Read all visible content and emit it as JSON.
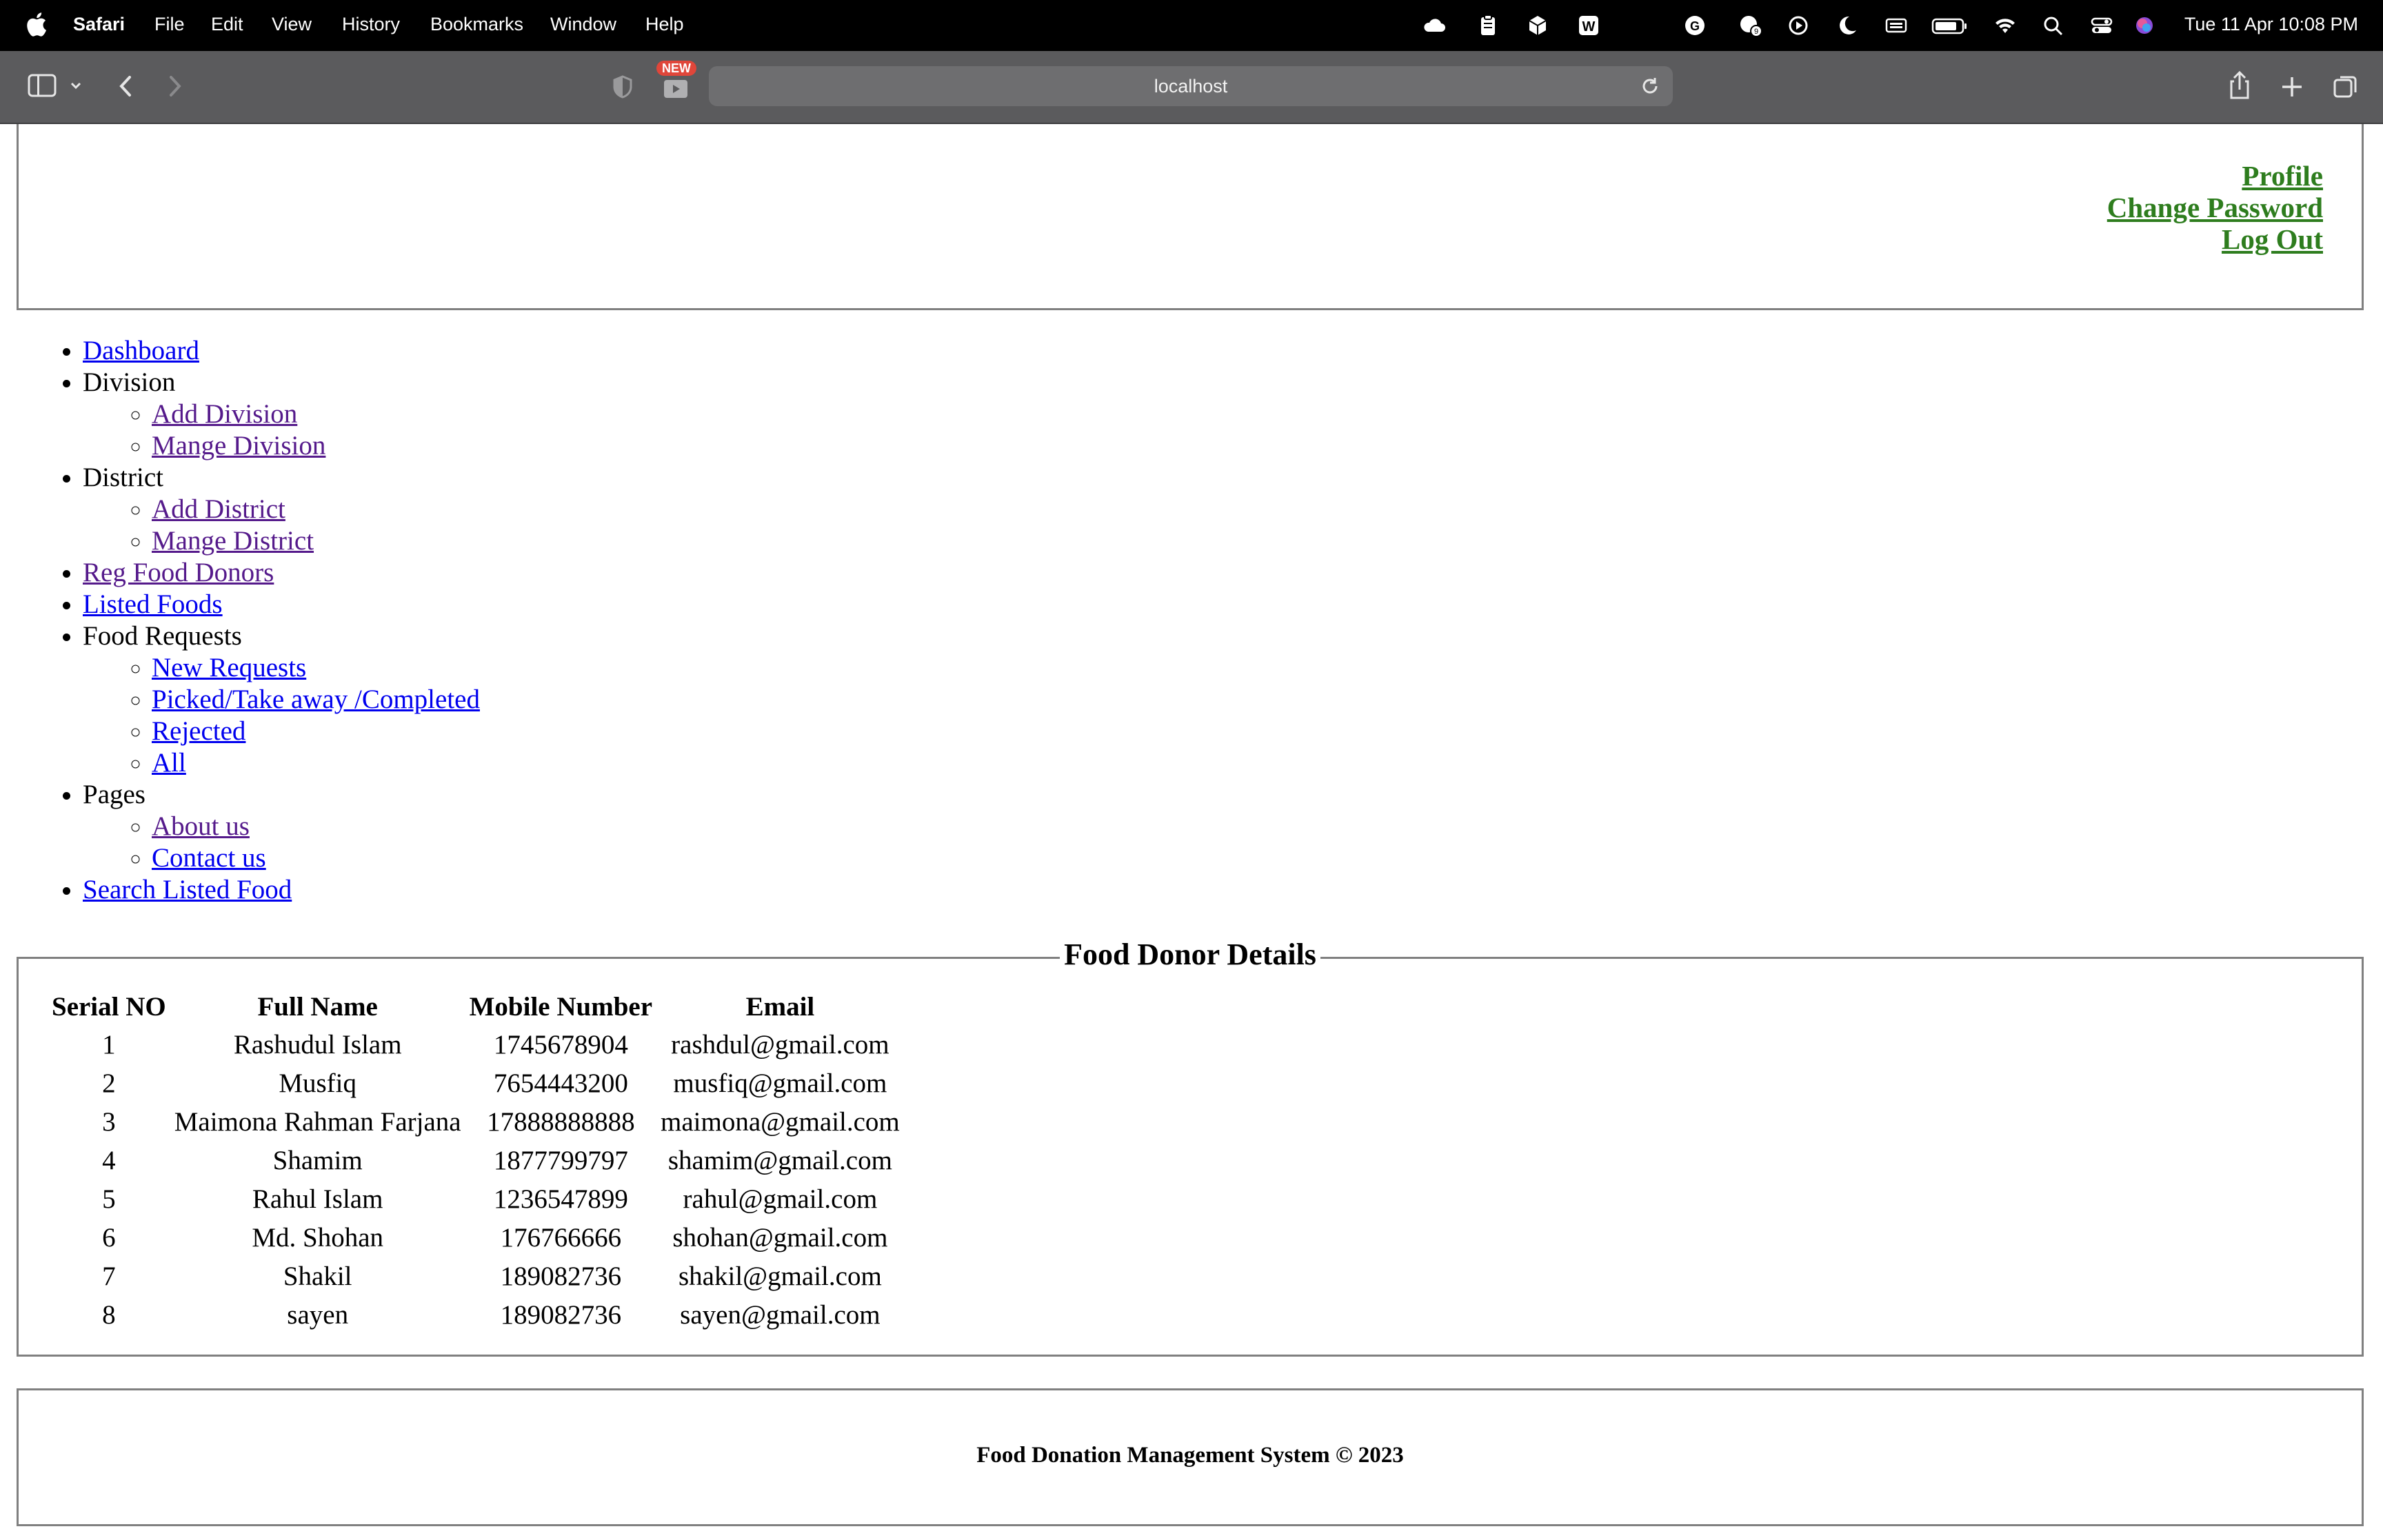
{
  "menubar": {
    "app_name": "Safari",
    "menus": [
      "File",
      "Edit",
      "View",
      "History",
      "Bookmarks",
      "Window",
      "Help"
    ],
    "tray_icons": [
      "cloud-icon",
      "clipboard-icon",
      "cube-icon",
      "word-icon",
      "grammarly-icon",
      "chat-icon",
      "play-icon",
      "moon-icon",
      "keyboard-icon",
      "battery-icon",
      "wifi-icon",
      "search-icon",
      "control-center-icon",
      "siri-icon"
    ],
    "clock": "Tue 11 Apr  10:08 PM"
  },
  "toolbar": {
    "url": "localhost",
    "new_badge": "NEW"
  },
  "header": {
    "links": [
      "Profile",
      "Change Password",
      "Log Out"
    ],
    "link_color": "#2e7d1e"
  },
  "nav": {
    "dashboard": "Dashboard",
    "division": {
      "label": "Division",
      "items": [
        "Add Division",
        "Mange Division"
      ]
    },
    "district": {
      "label": "District",
      "items": [
        "Add District",
        "Mange District"
      ]
    },
    "reg_food_donors": "Reg Food Donors",
    "listed_foods": "Listed Foods",
    "food_requests": {
      "label": "Food Requests",
      "items": [
        "New Requests",
        "Picked/Take away /Completed",
        "Rejected",
        "All"
      ]
    },
    "pages": {
      "label": "Pages",
      "items": [
        "About us",
        "Contact us"
      ]
    },
    "search_listed_food": "Search Listed Food"
  },
  "details": {
    "legend": "Food Donor Details",
    "columns": [
      "Serial NO",
      "Full Name",
      "Mobile Number",
      "Email"
    ],
    "rows": [
      [
        "1",
        "Rashudul Islam",
        "1745678904",
        "rashdul@gmail.com"
      ],
      [
        "2",
        "Musfiq",
        "7654443200",
        "musfiq@gmail.com"
      ],
      [
        "3",
        "Maimona Rahman Farjana",
        "17888888888",
        "maimona@gmail.com"
      ],
      [
        "4",
        "Shamim",
        "1877799797",
        "shamim@gmail.com"
      ],
      [
        "5",
        "Rahul Islam",
        "1236547899",
        "rahul@gmail.com"
      ],
      [
        "6",
        "Md. Shohan",
        "176766666",
        "shohan@gmail.com"
      ],
      [
        "7",
        "Shakil",
        "189082736",
        "shakil@gmail.com"
      ],
      [
        "8",
        "sayen",
        "189082736",
        "sayen@gmail.com"
      ]
    ]
  },
  "footer": {
    "text": "Food Donation Management System © 2023"
  }
}
